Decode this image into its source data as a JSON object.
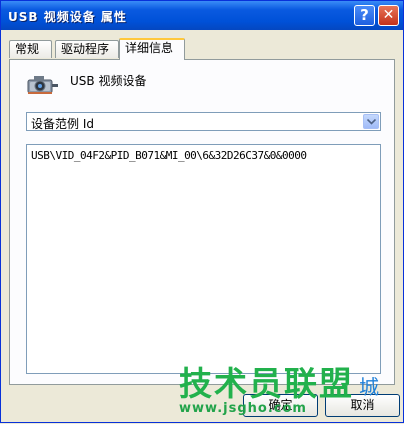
{
  "window": {
    "title": "USB 视频设备 属性"
  },
  "titlebar": {
    "help_label": "?",
    "close_label": "✕"
  },
  "tabs": [
    {
      "label": "常规",
      "active": false
    },
    {
      "label": "驱动程序",
      "active": false
    },
    {
      "label": "详细信息",
      "active": true
    }
  ],
  "device": {
    "name": "USB 视频设备",
    "icon": "camera-device-icon"
  },
  "property_select": {
    "value": "设备范例 Id"
  },
  "values_list": {
    "items": [
      "USB\\VID_04F2&PID_B071&MI_00\\6&32D26C37&0&0000"
    ]
  },
  "buttons": {
    "ok": "确定",
    "cancel": "取消"
  },
  "watermark": {
    "text_cn": "技术员联盟",
    "text_cn2": "城",
    "url": "www.jsgho.com"
  },
  "colors": {
    "titlebar": "#0A5AE0",
    "tab_highlight": "#FFC83C",
    "watermark": "#22B14C"
  }
}
